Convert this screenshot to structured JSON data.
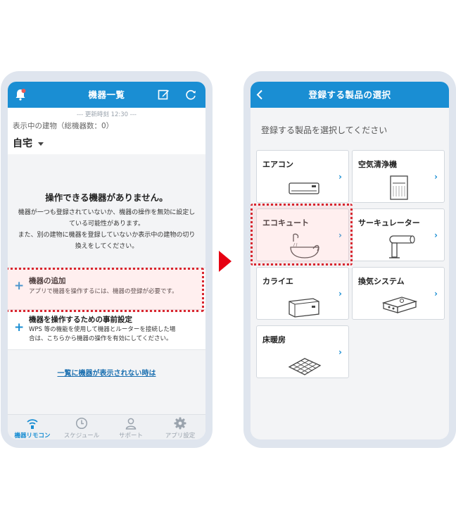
{
  "left_screen": {
    "header": {
      "title": "機器一覧"
    },
    "updated_text": "--- 更新時刻 12:30 ---",
    "building_label": "表示中の建物（総機器数：0）",
    "building_selected": "自宅",
    "empty": {
      "title": "操作できる機器がありません。",
      "lines": [
        "機器が一つも登録されていないか、機器の操作を無効に設定し",
        "ている可能性があります。",
        "また、別の建物に機器を登録していないか表示中の建物の切り",
        "換えをしてください。"
      ]
    },
    "actions": [
      {
        "title": "機器の追加",
        "desc": [
          "アプリで機器を操作するには、機器の登録が必要です。"
        ]
      },
      {
        "title": "機器を操作するための事前設定",
        "desc": [
          "WPS 等の機能を使用して機器とルーターを接続した場",
          "合は、こちらから機器の操作を有効にしてください。"
        ]
      }
    ],
    "help_link": "一覧に機器が表示されない時は",
    "tabs": [
      {
        "label": "機器リモコン",
        "icon": "wifi-icon"
      },
      {
        "label": "スケジュール",
        "icon": "clock-icon"
      },
      {
        "label": "サポート",
        "icon": "person-icon"
      },
      {
        "label": "アプリ設定",
        "icon": "gear-icon"
      }
    ]
  },
  "right_screen": {
    "header": {
      "title": "登録する製品の選択"
    },
    "hint": "登録する製品を選択してください",
    "products": [
      {
        "name": "エアコン",
        "icon": "air-conditioner-icon"
      },
      {
        "name": "空気清浄機",
        "icon": "air-purifier-icon"
      },
      {
        "name": "エコキュート",
        "icon": "eco-cute-icon"
      },
      {
        "name": "サーキュレーター",
        "icon": "circulator-icon"
      },
      {
        "name": "カライエ",
        "icon": "karaie-icon"
      },
      {
        "name": "換気システム",
        "icon": "ventilation-icon"
      },
      {
        "name": "床暖房",
        "icon": "floor-heating-icon"
      }
    ],
    "chevron": "›"
  },
  "colors": {
    "accent": "#1a8ed3",
    "highlight": "#d8262f",
    "arrow": "#e60012"
  }
}
